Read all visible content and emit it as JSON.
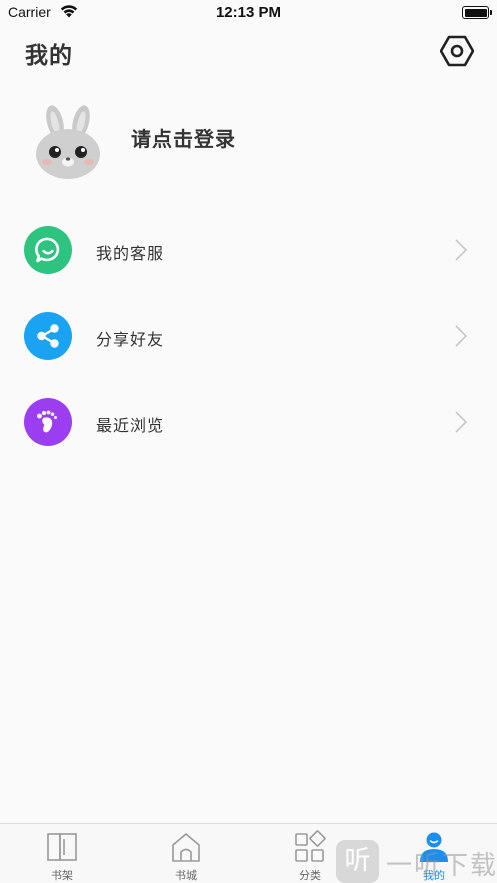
{
  "status_bar": {
    "carrier": "Carrier",
    "time": "12:13 PM",
    "battery_level": 0.92
  },
  "header": {
    "title": "我的",
    "settings_icon": "settings-hexagon-icon"
  },
  "profile": {
    "login_prompt": "请点击登录",
    "avatar_icon": "bunny-avatar-icon"
  },
  "menu": [
    {
      "label": "我的客服",
      "icon": "chat-bubble-icon",
      "color": "#2ec37f"
    },
    {
      "label": "分享好友",
      "icon": "share-icon",
      "color": "#19a3f2"
    },
    {
      "label": "最近浏览",
      "icon": "footprint-icon",
      "color": "#9b3ef2"
    }
  ],
  "tabs": [
    {
      "label": "书架",
      "icon": "bookshelf-icon",
      "active": false
    },
    {
      "label": "书城",
      "icon": "home-icon",
      "active": false
    },
    {
      "label": "分类",
      "icon": "category-icon",
      "active": false
    },
    {
      "label": "我的",
      "icon": "profile-icon",
      "active": true
    }
  ],
  "colors": {
    "accent": "#1a8ff0",
    "background": "#fafafa"
  },
  "watermark": {
    "glyph": "听",
    "text": "一听下载"
  }
}
